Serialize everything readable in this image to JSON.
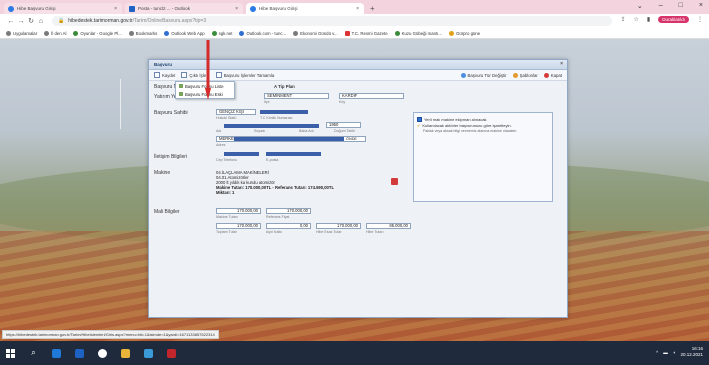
{
  "browser": {
    "tabs": [
      {
        "label": "Hibe Başvuru Girişi",
        "active": false
      },
      {
        "label": "Posta - tuncl2 ... - Outlook",
        "active": false
      },
      {
        "label": "Hibe Başvuru Girişi",
        "active": true
      }
    ],
    "url_prefix": "hibedestek.tarimorman.gov.tr",
    "url_path": "/Tarim/OnlineBasvuru.aspx?tip=3",
    "profile_label": "Duraklatıldı",
    "bookmarks": [
      {
        "label": "Uygulamalar",
        "color": "#7a7a7a"
      },
      {
        "label": "İl den Al",
        "color": "#7a7a7a"
      },
      {
        "label": "Oyunlar - Google Pl...",
        "color": "#3a8c3a"
      },
      {
        "label": "Bookmarks",
        "color": "#7a7a7a"
      },
      {
        "label": "Outlook Web App",
        "color": "#2f6fd1"
      },
      {
        "label": "sgk.net",
        "color": "#3a8c3a"
      },
      {
        "label": "Outlook.com - tunc...",
        "color": "#2f6fd1"
      },
      {
        "label": "Ekonomi Gündü v...",
        "color": "#7a7a7a"
      },
      {
        "label": "T.C. Resmi Gazete",
        "color": "#d33"
      },
      {
        "label": "Kuzu Gübeği mantı...",
        "color": "#3a8c3a"
      },
      {
        "label": "Gürpro güne",
        "color": "#e1a21a"
      }
    ]
  },
  "modal": {
    "title": "Başvuru",
    "close": "×",
    "toolbar": {
      "left": [
        "Kaydet",
        "Çıktı İşle...",
        "Başvuru İşlemler Tamamla"
      ],
      "right": [
        "Başvuru Tür Değiştir",
        "Şablonlar",
        "Kapat"
      ]
    },
    "dropdown": [
      "Başvuru Formu Liste",
      "Başvuru Formu Eski"
    ],
    "form": {
      "section_label": "A Tip Plan",
      "row1_label": "Başvuru No",
      "row2_label": "Yatırım Yeri",
      "row2_select": "SEMİNMENT",
      "row2_select2": "KARDİF",
      "row2_sub1": "İlçe",
      "row2_sub2": "Köy",
      "owner_label": "Başvuru Sahibi",
      "owner_name": "GENÇİZ KİŞİ",
      "owner_sub1": "Hukuki Statü",
      "owner_sub2": "T.C Kimlik Numarası",
      "owner_row2_sub1": "Adı",
      "owner_row2_sub2": "Soyadı",
      "owner_row2_sub3": "Baba Adı",
      "owner_row2_sub4": "Doğum Tarihi",
      "owner_row2_val": "1950",
      "address_prefix": "MERKEZ",
      "address_suffix": "ÖNDE",
      "address_sub": "Adres",
      "contact_label": "İletişim Bilgileri",
      "contact_sub1": "Cep Telefonu",
      "contact_sub2": "E-posta",
      "machine_label": "Makine",
      "machine_line1": "04.İLAÇLAMA MAKİNELERİ",
      "machine_line2": "04.01.Atomizörler",
      "machine_line3": "2000 lt yıldık ka kurulu atomizör",
      "machine_cost": "Makine Tutarı: 170.000,00TL - Referans Tutarı: 174.590,00TL",
      "machine_qty": "Miktarı: 1",
      "finance_label": "Mali Bilgiler",
      "finance_v1": "170.000,00",
      "finance_v2": "170.000,00",
      "finance_sub1": "Makine Tutarı",
      "finance_sub2": "Referans Fiyat",
      "finance_v3": "170.000,00",
      "finance_v4": "0,00",
      "finance_v5": "170.000,00",
      "finance_v6": "85.000,00",
      "finance_sub3": "Toplam Tutar",
      "finance_sub4": "Ayni Katkı",
      "finance_sub5": "Hibe Esas Tutar",
      "finance_sub6": "Hibe Tutarı"
    },
    "info": {
      "check_label": "Yerli malı makine ekipman alınacak",
      "check2_label": "Kullanılacak aktörler başvurunuzu göre işaretleyin.",
      "text": "Faklak veya aksak bilgi vermemiz alanına makine olacaktır."
    }
  },
  "status_url": "https://hibedestek.tarimorman.gov.tr/Tarim/HibeIslemleri/Giris.aspx?menu=hib-1&isimde=1&yardi=1671133857522314",
  "taskbar": {
    "time": "16:16",
    "date": "20.12.2021"
  }
}
